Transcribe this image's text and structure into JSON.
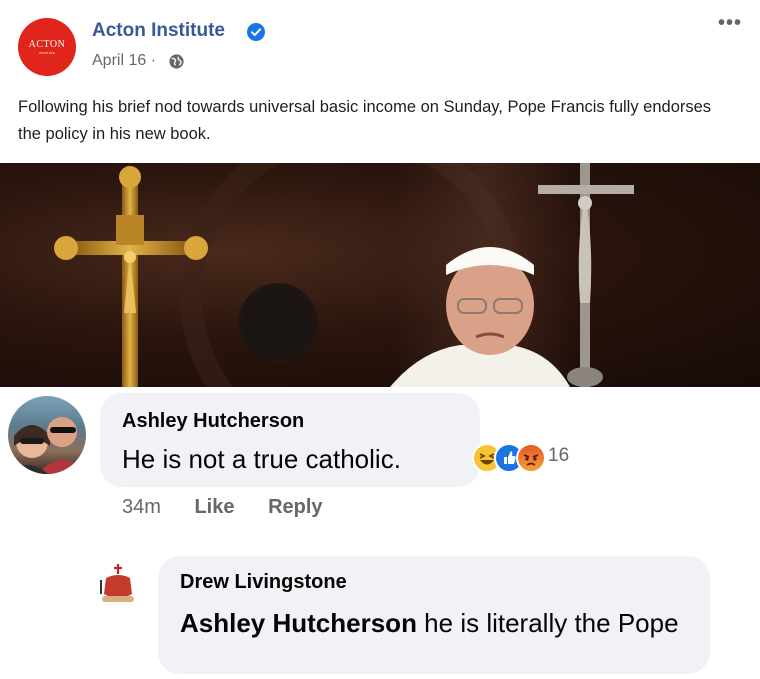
{
  "post": {
    "page_name": "Acton Institute",
    "date": "April 16 ·",
    "avatar_text": "ACTON",
    "avatar_subtext": "INSTITUTE",
    "more_label": "•••",
    "body": "Following his brief nod towards universal basic income on Sunday, Pope Francis fully endorses the policy in his new book."
  },
  "comments": [
    {
      "author": "Ashley Hutcherson",
      "text": "He is not a true catholic.",
      "reaction_count": "16",
      "reactions": [
        "haha",
        "like",
        "angry"
      ],
      "time": "34m",
      "like_label": "Like",
      "reply_label": "Reply"
    },
    {
      "author": "Drew Livingstone",
      "mention": "Ashley Hutcherson",
      "text": " he is literally the Pope"
    }
  ],
  "colors": {
    "page_name": "#385898",
    "verified": "#1b74e4",
    "bubble": "#f0f2f5",
    "meta": "#65676b",
    "acton_red": "#e0261c"
  }
}
